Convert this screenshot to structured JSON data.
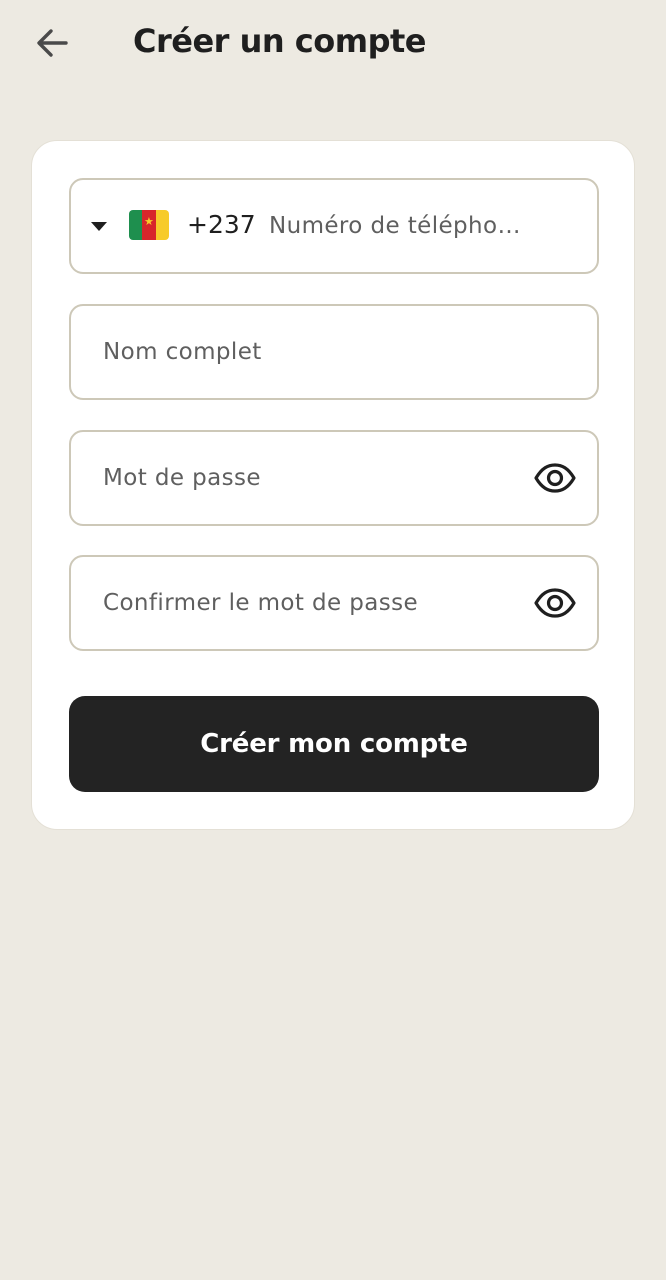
{
  "header": {
    "title": "Créer un compte",
    "back_icon": "arrow-left-icon"
  },
  "form": {
    "phone": {
      "country_flag": "cameroon-flag-icon",
      "dial_code": "+237",
      "placeholder": "Numéro de télépho…",
      "value": ""
    },
    "full_name": {
      "placeholder": "Nom complet",
      "value": ""
    },
    "password": {
      "placeholder": "Mot de passe",
      "value": "",
      "toggle_icon": "eye-icon"
    },
    "confirm_password": {
      "placeholder": "Confirmer le mot de passe",
      "value": "",
      "toggle_icon": "eye-icon"
    },
    "submit_label": "Créer mon compte"
  },
  "colors": {
    "background": "#EDEAE2",
    "card": "#FFFFFF",
    "field_border": "#CDC8B8",
    "button": "#232323",
    "button_text": "#FFFFFF"
  }
}
